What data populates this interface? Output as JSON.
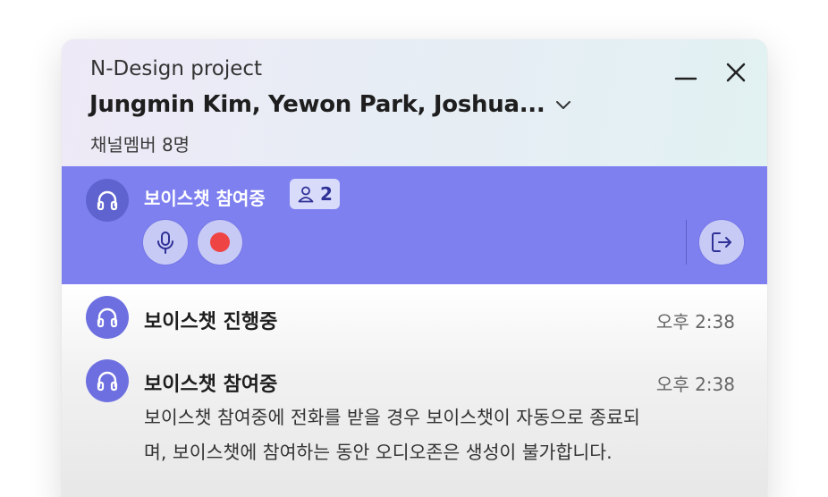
{
  "header": {
    "project": "N-Design project",
    "title": "Jungmin Kim, Yewon Park, Joshua...",
    "members": "채널멤버 8명"
  },
  "voice_bar": {
    "status": "보이스챗 참여중",
    "participant_count": "2",
    "colors": {
      "background": "#7e80f0",
      "record": "#ef4444"
    }
  },
  "messages": [
    {
      "title": "보이스챗 진행중",
      "time": "오후 2:38"
    },
    {
      "title": "보이스챗 참여중",
      "time": "오후 2:38",
      "body_lines": [
        "보이스챗 참여중에 전화를 받을 경우 보이스챗이 자동으로 종료되",
        "며, 보이스챗에 참여하는 동안 오디오존은 생성이 불가합니다."
      ]
    }
  ],
  "icons": [
    "chevron-down-icon",
    "minimize-icon",
    "close-icon",
    "headphones-icon",
    "person-icon",
    "microphone-icon",
    "record-icon",
    "leave-icon"
  ]
}
